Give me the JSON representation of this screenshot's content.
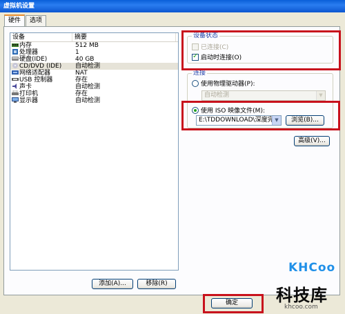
{
  "window": {
    "title": "虚拟机设置"
  },
  "tabs": [
    {
      "label": "硬件"
    },
    {
      "label": "选项"
    }
  ],
  "device_list": {
    "columns": [
      "设备",
      "摘要"
    ],
    "rows": [
      {
        "icon": "memory-icon",
        "device": "内存",
        "summary": "512 MB"
      },
      {
        "icon": "cpu-icon",
        "device": "处理器",
        "summary": "1"
      },
      {
        "icon": "hard-disk-icon",
        "device": "硬盘(IDE)",
        "summary": "40 GB"
      },
      {
        "icon": "cd-dvd-icon",
        "device": "CD/DVD (IDE)",
        "summary": "自动检测",
        "selected": true
      },
      {
        "icon": "network-adapter-icon",
        "device": "网络适配器",
        "summary": "NAT"
      },
      {
        "icon": "usb-icon",
        "device": "USB 控制器",
        "summary": "存在"
      },
      {
        "icon": "sound-icon",
        "device": "声卡",
        "summary": "自动检测"
      },
      {
        "icon": "printer-icon",
        "device": "打印机",
        "summary": "存在"
      },
      {
        "icon": "display-icon",
        "device": "显示器",
        "summary": "自动检测"
      }
    ],
    "add_button": "添加(A)...",
    "remove_button": "移除(R)"
  },
  "device_status": {
    "legend": "设备状态",
    "connected": {
      "label": "已连接(C)",
      "checked": false,
      "disabled": true
    },
    "connect_at_power_on": {
      "label": "启动时连接(O)",
      "checked": true
    }
  },
  "connection": {
    "legend": "连接",
    "physical_drive": {
      "label": "使用物理驱动器(P):",
      "selected": false
    },
    "physical_drive_value": "自动检测",
    "iso_image": {
      "label": "使用 ISO 映像文件(M):",
      "selected": true
    },
    "iso_path": "E:\\TDDOWNLOAD\\深度完美",
    "browse_button": "浏览(B)..."
  },
  "advanced_button": "高级(V)...",
  "ok_button": "确定",
  "watermark": {
    "brand": "KHCoo",
    "name": "科技库",
    "url": "khcoo.com"
  },
  "colors": {
    "highlight": "#c8111c",
    "titlebar": "#0a5fd8"
  }
}
